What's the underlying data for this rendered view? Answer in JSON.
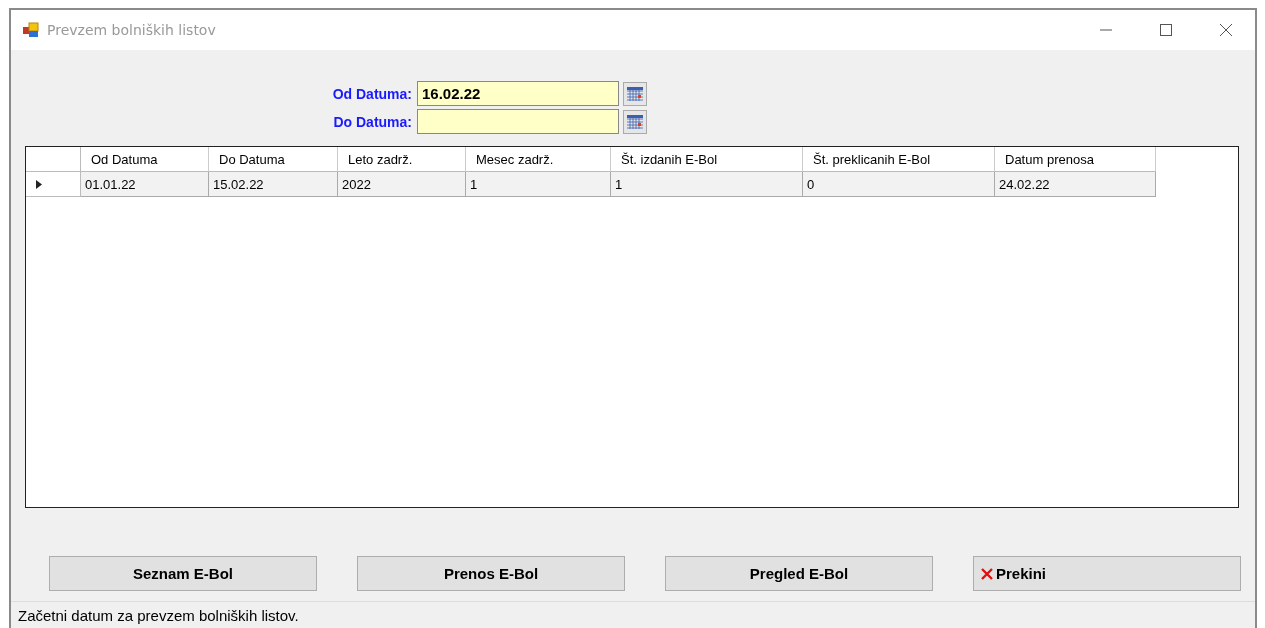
{
  "window": {
    "title": "Prevzem bolniških listov"
  },
  "date_fields": [
    {
      "label": "Od Datuma:",
      "value": "16.02.22"
    },
    {
      "label": "Do Datuma:"
    }
  ],
  "table": {
    "columns": [
      "Od Datuma",
      "Do Datuma",
      "Leto zadrž.",
      "Mesec zadrž.",
      "Št. izdanih E-Bol",
      "Št. preklicanih E-Bol",
      "Datum prenosa"
    ],
    "rows": [
      {
        "current": true,
        "cells": [
          "01.01.22",
          "15.02.22",
          "2022",
          "1",
          "1",
          "0",
          "24.02.22"
        ]
      }
    ]
  },
  "buttons": [
    {
      "label": "Seznam E-Bol",
      "kind": "plain"
    },
    {
      "label": "Prenos E-Bol",
      "kind": "plain"
    },
    {
      "label": "Pregled E-Bol",
      "kind": "plain"
    },
    {
      "label": "Prekini",
      "kind": "cancel"
    }
  ],
  "status_bar": "Začetni datum za prevzem bolniških listov."
}
